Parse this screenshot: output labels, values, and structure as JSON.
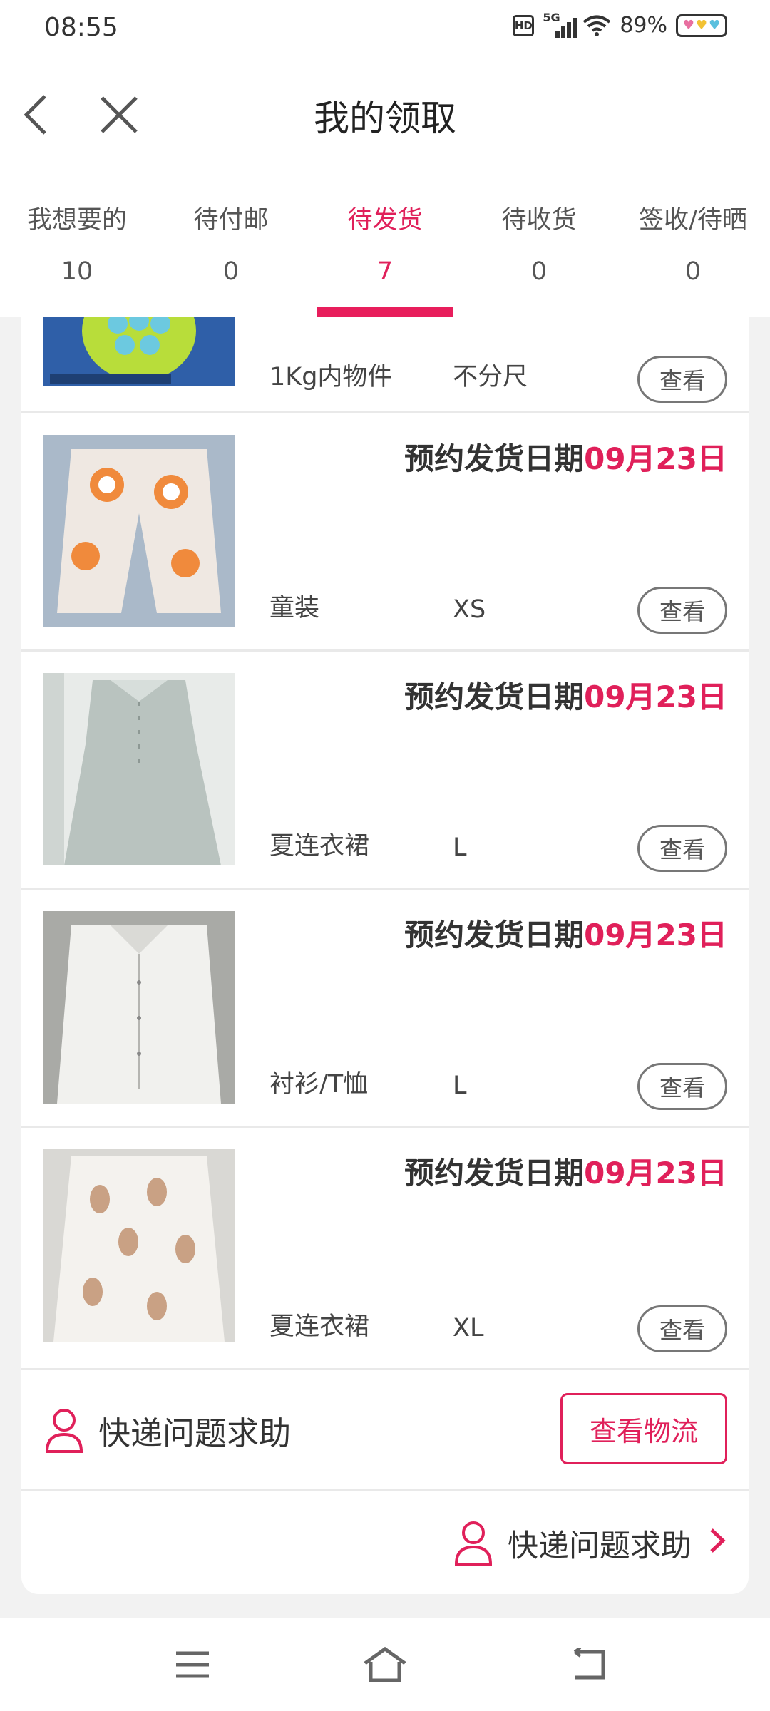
{
  "status": {
    "time": "08:55",
    "hd": "HD",
    "network": "5G",
    "battery": "89%"
  },
  "header": {
    "title": "我的领取"
  },
  "tabs": [
    {
      "label": "我想要的",
      "count": "10"
    },
    {
      "label": "待付邮",
      "count": "0"
    },
    {
      "label": "待发货",
      "count": "7",
      "active": true
    },
    {
      "label": "待收货",
      "count": "0"
    },
    {
      "label": "签收/待晒",
      "count": "0"
    }
  ],
  "items": [
    {
      "category": "1Kg内物件",
      "size": "不分尺",
      "view": "查看",
      "image": "green-puzzle-toy"
    },
    {
      "date_label": "预约发货日期",
      "date": "09月23日",
      "category": "童装",
      "size": "XS",
      "view": "查看",
      "image": "kids-pants"
    },
    {
      "date_label": "预约发货日期",
      "date": "09月23日",
      "category": "夏连衣裙",
      "size": "L",
      "view": "查看",
      "image": "grey-dress"
    },
    {
      "date_label": "预约发货日期",
      "date": "09月23日",
      "category": "衬衫/T恤",
      "size": "L",
      "view": "查看",
      "image": "white-shirt"
    },
    {
      "date_label": "预约发货日期",
      "date": "09月23日",
      "category": "夏连衣裙",
      "size": "XL",
      "view": "查看",
      "image": "llama-dress"
    }
  ],
  "help": {
    "label": "快递问题求助",
    "logistics_button": "查看物流"
  },
  "footer_help": {
    "label": "快递问题求助"
  },
  "colors": {
    "accent": "#e0205a",
    "indicator": "#e81e5c",
    "background": "#f2f2f2"
  }
}
